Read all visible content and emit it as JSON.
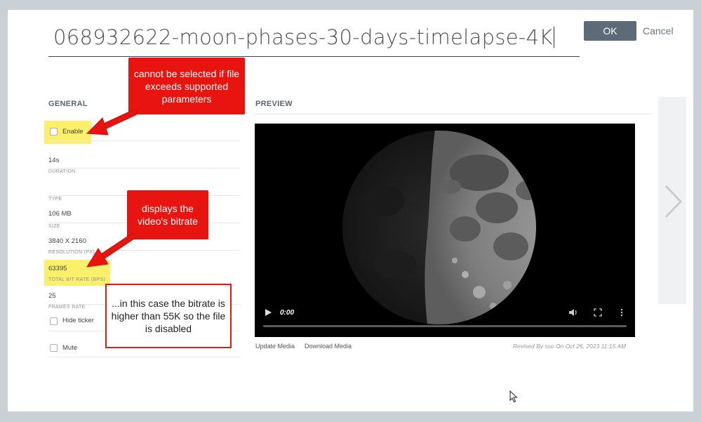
{
  "header": {
    "filename": "068932622-moon-phases-30-days-timelapse-4K",
    "ok_label": "OK",
    "cancel_label": "Cancel"
  },
  "general": {
    "heading": "GENERAL",
    "enable_label": "Enable",
    "fields": [
      {
        "value": "14s",
        "label": "DURATION"
      },
      {
        "value": "",
        "label": "TYPE"
      },
      {
        "value": "106 MB",
        "label": "SIZE"
      },
      {
        "value": "3840 X 2160",
        "label": "RESOLUTION (PX)"
      },
      {
        "value": "63395",
        "label": "TOTAL BIT RATE (BPS)"
      },
      {
        "value": "25",
        "label": "FRAMES RATE"
      }
    ],
    "hide_ticker_label": "Hide ticker",
    "mute_label": "Mute"
  },
  "preview": {
    "heading": "PREVIEW",
    "video_time": "0:00",
    "update_media": "Update Media",
    "download_media": "Download Media",
    "revised": "Revised By sso On Oct 26, 2023 11:15 AM"
  },
  "annotations": {
    "callout_enable": "cannot be selected if file exceeds supported parameters",
    "callout_bitrate": "displays the video's bitrate",
    "note_bitrate": "...in this case the bitrate is higher than 55K so the file is disabled"
  },
  "colors": {
    "callout_red": "#e8140f",
    "highlight_yellow": "#fcf06a",
    "ok_button": "#5d6b78"
  }
}
